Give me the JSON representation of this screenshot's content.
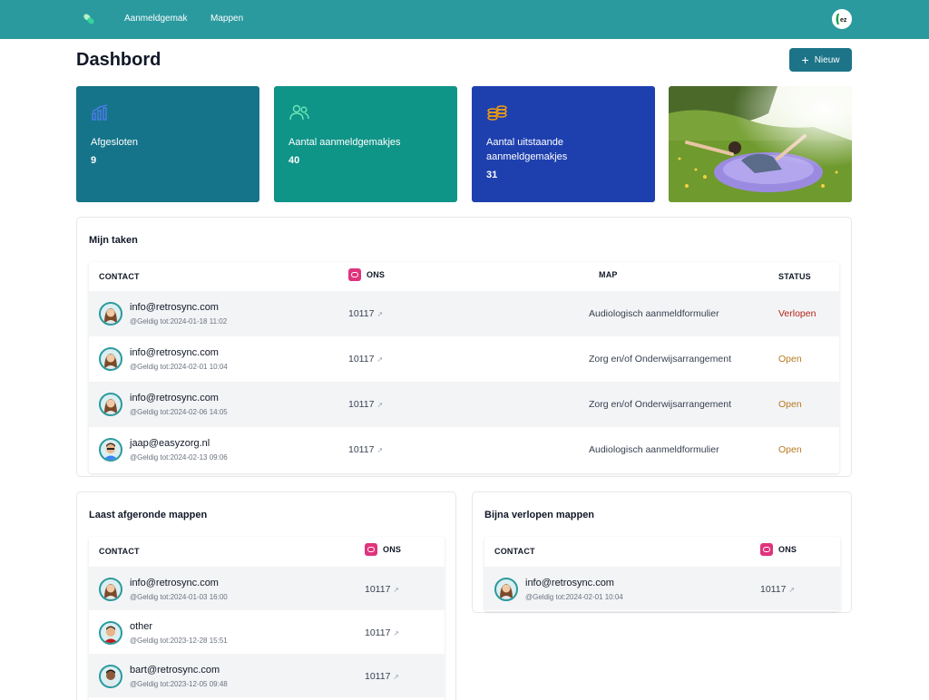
{
  "nav": {
    "links": [
      "Aanmeldgemak",
      "Mappen"
    ],
    "logo_icon": "leaf-logo-icon",
    "accent": "#2a9a9f"
  },
  "page": {
    "title": "Dashbord",
    "new_button": "Nieuw"
  },
  "stats": [
    {
      "label": "Afgesloten",
      "value": "9",
      "icon": "chart-icon",
      "color": "#15748a"
    },
    {
      "label": "Aantal aanmeldgemakjes",
      "value": "40",
      "icon": "users-icon",
      "color": "#0f9488"
    },
    {
      "label": "Aantal uitstaande aanmeldgemakjes",
      "value": "31",
      "icon": "coins-icon",
      "color": "#1e40af"
    }
  ],
  "tasks": {
    "title": "Mijn taken",
    "headers": {
      "contact": "CONTACT",
      "ons": "ONS",
      "map": "MAP",
      "status": "STATUS"
    },
    "rows": [
      {
        "contact": "info@retrosync.com",
        "valid": "@Geldig tot:2024-01-18 11:02",
        "ons": "10117",
        "map": "Audiologisch aanmeldformulier",
        "status": "Verlopen",
        "status_color": "#b42318"
      },
      {
        "contact": "info@retrosync.com",
        "valid": "@Geldig tot:2024-02-01 10:04",
        "ons": "10117",
        "map": "Zorg en/of Onderwijsarrangement",
        "status": "Open",
        "status_color": "#b7791f"
      },
      {
        "contact": "info@retrosync.com",
        "valid": "@Geldig tot:2024-02-06 14:05",
        "ons": "10117",
        "map": "Zorg en/of Onderwijsarrangement",
        "status": "Open",
        "status_color": "#b7791f"
      },
      {
        "contact": "jaap@easyzorg.nl",
        "valid": "@Geldig tot:2024-02-13 09:06",
        "ons": "10117",
        "map": "Audiologisch aanmeldformulier",
        "status": "Open",
        "status_color": "#b7791f"
      }
    ]
  },
  "completed": {
    "title": "Laast afgeronde mappen",
    "headers": {
      "contact": "CONTACT",
      "ons": "ONS"
    },
    "rows": [
      {
        "contact": "info@retrosync.com",
        "valid": "@Geldig tot:2024-01-03 16:00",
        "ons": "10117"
      },
      {
        "contact": "other",
        "valid": "@Geldig tot:2023-12-28 15:51",
        "ons": "10117"
      },
      {
        "contact": "bart@retrosync.com",
        "valid": "@Geldig tot:2023-12-05 09:48",
        "ons": "10117"
      }
    ]
  },
  "expiring": {
    "title": "Bijna verlopen mappen",
    "headers": {
      "contact": "CONTACT",
      "ons": "ONS"
    },
    "rows": [
      {
        "contact": "info@retrosync.com",
        "valid": "@Geldig tot:2024-02-01 10:04",
        "ons": "10117"
      }
    ]
  }
}
